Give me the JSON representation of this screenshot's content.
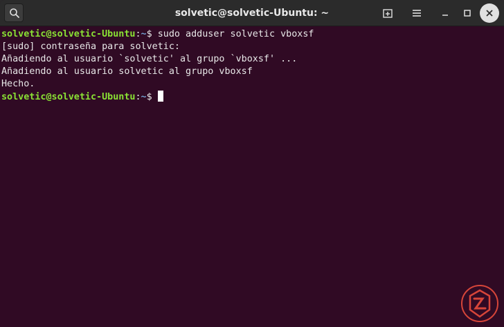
{
  "window": {
    "title": "solvetic@solvetic-Ubuntu: ~"
  },
  "titlebar": {
    "icons": {
      "search": "search-icon",
      "new_tab": "new-tab-icon",
      "menu": "hamburger-menu-icon",
      "minimize": "minimize-icon",
      "maximize": "maximize-icon",
      "close": "close-icon"
    }
  },
  "terminal": {
    "prompt": {
      "user_host": "solvetic@solvetic-Ubuntu",
      "colon": ":",
      "path": "~",
      "sign": "$ "
    },
    "command": "sudo adduser solvetic vboxsf",
    "output": [
      "[sudo] contraseña para solvetic:",
      "Añadiendo al usuario `solvetic' al grupo `vboxsf' ...",
      "Añadiendo al usuario solvetic al grupo vboxsf",
      "Hecho."
    ]
  },
  "colors": {
    "terminal_background": "#300a24",
    "titlebar_background": "#2b2b2b",
    "prompt_user": "#8ae234",
    "prompt_path": "#729fcf",
    "text": "#e8e8e8",
    "watermark": "#e94b3c"
  },
  "watermark": {
    "icon": "solvetic-logo-icon"
  }
}
